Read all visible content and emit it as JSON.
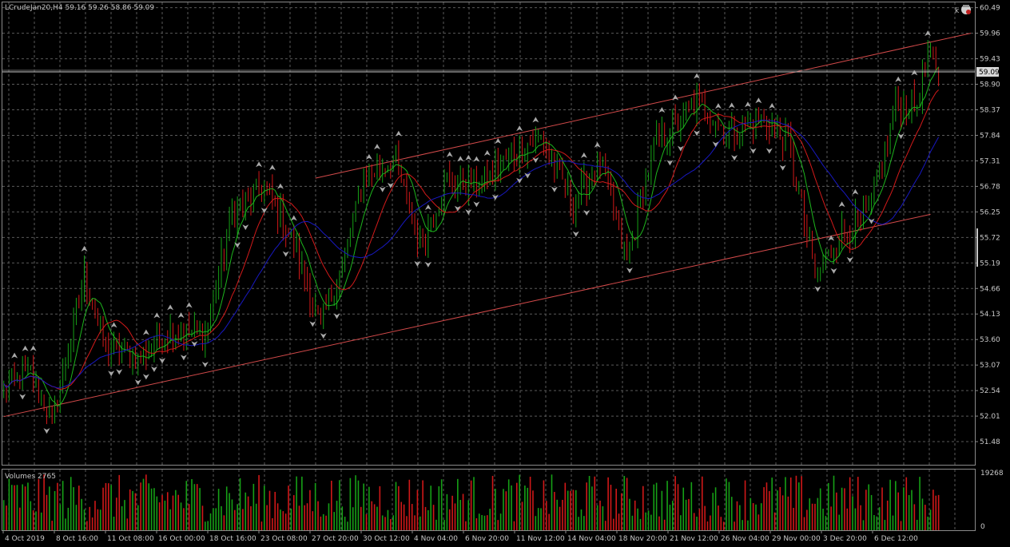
{
  "header": {
    "symbol_line": "LCrudeJan20,H4  59.16 59.26 58.86 59.09",
    "corner_k": "k"
  },
  "volume_panel": {
    "title": "Volumes 2765",
    "scale_top": "19268",
    "scale_bottom": "0"
  },
  "current_price_label": "59.09",
  "colors": {
    "background": "#000000",
    "grid": "#5a5a5a",
    "bull_candle": "#16a016",
    "bear_candle": "#d01818",
    "ma_fast": "#1db51d",
    "ma_mid": "#d21a1a",
    "ma_slow": "#1818c0",
    "channel": "#d24a4a",
    "fractal": "#a8a8a8",
    "text": "#c8c8c8",
    "bid_line": "#c8c8c8"
  },
  "chart_data": {
    "type": "candlestick",
    "symbol": "LCrudeJan20",
    "timeframe": "H4",
    "last_bar": {
      "open": 59.16,
      "high": 59.26,
      "low": 58.86,
      "close": 59.09
    },
    "y_tick_labels": [
      "60.49",
      "59.96",
      "59.43",
      "58.90",
      "58.37",
      "57.84",
      "57.31",
      "56.78",
      "56.25",
      "55.72",
      "55.19",
      "54.66",
      "54.13",
      "53.60",
      "53.07",
      "52.54",
      "52.01",
      "51.48"
    ],
    "ylim": [
      51.0,
      60.6
    ],
    "x_tick_labels": [
      "4 Oct 2019",
      "8 Oct 16:00",
      "11 Oct 08:00",
      "16 Oct 00:00",
      "18 Oct 16:00",
      "23 Oct 08:00",
      "27 Oct 20:00",
      "30 Oct 12:00",
      "4 Nov 04:00",
      "6 Nov 20:00",
      "11 Nov 12:00",
      "14 Nov 04:00",
      "18 Nov 20:00",
      "21 Nov 12:00",
      "26 Nov 04:00",
      "29 Nov 00:00",
      "3 Dec 20:00",
      "6 Dec 12:00"
    ],
    "price_path_keypoints": [
      {
        "bar": 0,
        "price": 52.6
      },
      {
        "bar": 10,
        "price": 52.9
      },
      {
        "bar": 18,
        "price": 51.9
      },
      {
        "bar": 30,
        "price": 54.9
      },
      {
        "bar": 38,
        "price": 53.4
      },
      {
        "bar": 50,
        "price": 53.2
      },
      {
        "bar": 62,
        "price": 53.8
      },
      {
        "bar": 75,
        "price": 53.7
      },
      {
        "bar": 85,
        "price": 56.2
      },
      {
        "bar": 97,
        "price": 56.8
      },
      {
        "bar": 108,
        "price": 55.6
      },
      {
        "bar": 118,
        "price": 53.9
      },
      {
        "bar": 126,
        "price": 55.1
      },
      {
        "bar": 134,
        "price": 56.9
      },
      {
        "bar": 145,
        "price": 57.4
      },
      {
        "bar": 155,
        "price": 55.6
      },
      {
        "bar": 165,
        "price": 56.9
      },
      {
        "bar": 178,
        "price": 56.8
      },
      {
        "bar": 188,
        "price": 57.4
      },
      {
        "bar": 200,
        "price": 57.8
      },
      {
        "bar": 212,
        "price": 56.4
      },
      {
        "bar": 222,
        "price": 57.3
      },
      {
        "bar": 232,
        "price": 55.2
      },
      {
        "bar": 242,
        "price": 57.6
      },
      {
        "bar": 258,
        "price": 58.5
      },
      {
        "bar": 270,
        "price": 57.9
      },
      {
        "bar": 282,
        "price": 58.2
      },
      {
        "bar": 292,
        "price": 57.7
      },
      {
        "bar": 302,
        "price": 54.9
      },
      {
        "bar": 312,
        "price": 55.8
      },
      {
        "bar": 322,
        "price": 56.2
      },
      {
        "bar": 332,
        "price": 58.4
      },
      {
        "bar": 340,
        "price": 58.5
      },
      {
        "bar": 344,
        "price": 59.5
      },
      {
        "bar": 348,
        "price": 59.09
      }
    ],
    "channel_upper": [
      {
        "bar": 116,
        "price": 56.95
      },
      {
        "bar": 360,
        "price": 59.96
      }
    ],
    "channel_lower": [
      {
        "bar": 0,
        "price": 52.0
      },
      {
        "bar": 345,
        "price": 56.2
      }
    ],
    "indicators": [
      "moving average fast (green)",
      "moving average medium (red)",
      "moving average slow (blue)",
      "fractals (arrows)",
      "volumes"
    ]
  }
}
